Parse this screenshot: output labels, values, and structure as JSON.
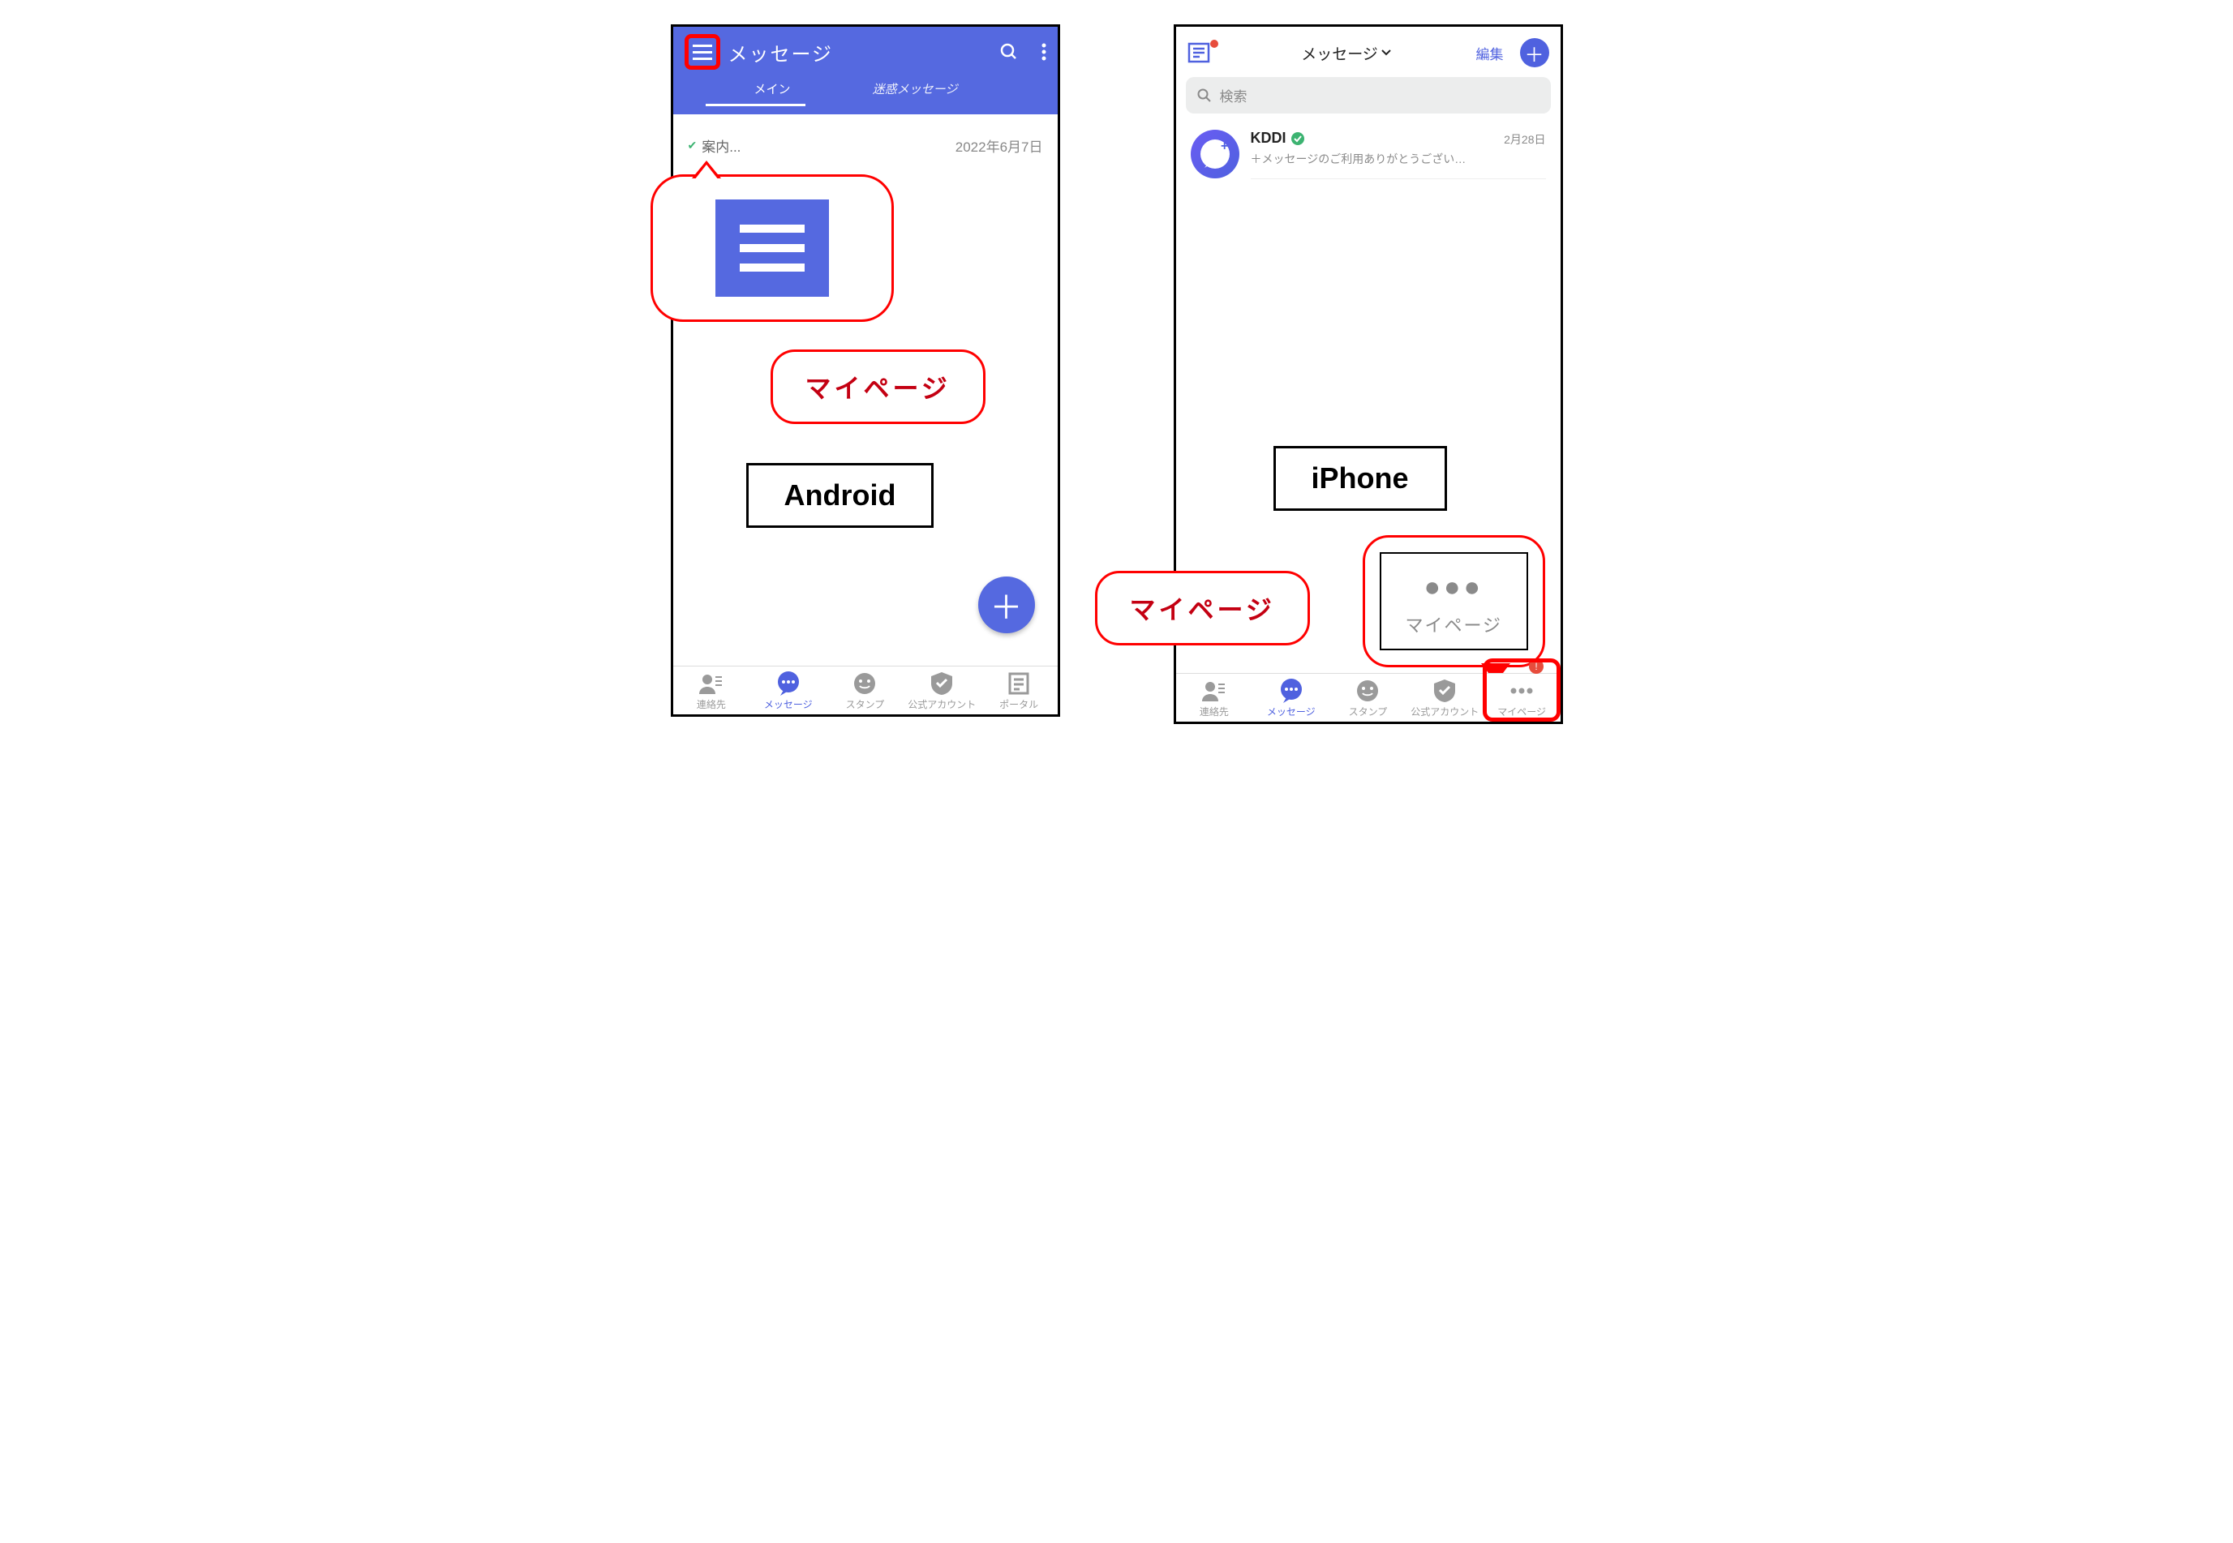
{
  "android": {
    "header": {
      "title": "メッセージ"
    },
    "tabs": {
      "main": "メイン",
      "spam": "迷惑メッセージ"
    },
    "message": {
      "snippet": "案内...",
      "date": "2022年6月7日"
    },
    "callout_mypage": "マイページ",
    "os_label": "Android",
    "nav": {
      "contacts": "連絡先",
      "messages": "メッセージ",
      "stamp": "スタンプ",
      "official": "公式アカウント",
      "portal": "ポータル"
    }
  },
  "iphone": {
    "header": {
      "title": "メッセージ",
      "edit": "編集"
    },
    "search_placeholder": "検索",
    "message": {
      "name": "KDDI",
      "snippet": "＋メッセージのご利用ありがとうござい…",
      "date": "2月28日"
    },
    "os_label": "iPhone",
    "callout_mypage": "マイページ",
    "callout_dots_label": "マイページ",
    "nav": {
      "contacts": "連絡先",
      "messages": "メッセージ",
      "stamp": "スタンプ",
      "official": "公式アカウント",
      "mypage": "マイページ"
    }
  }
}
